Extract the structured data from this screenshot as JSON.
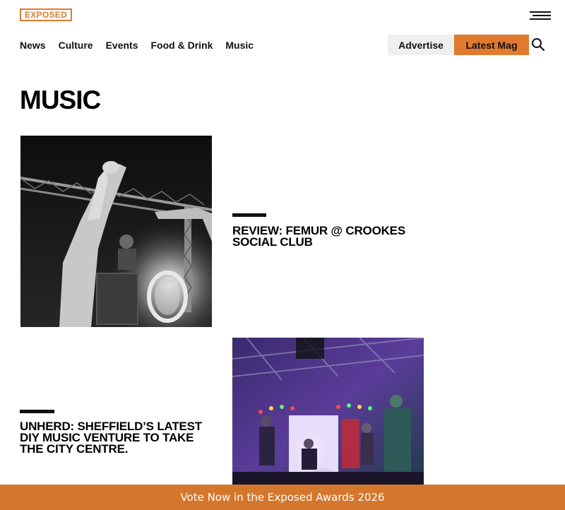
{
  "brand": {
    "logo_text": "EXPOSED",
    "accent_color": "#e07a2e"
  },
  "nav": {
    "items": [
      "News",
      "Culture",
      "Events",
      "Food & Drink",
      "Music"
    ],
    "advertise_label": "Advertise",
    "latest_mag_label": "Latest Mag"
  },
  "icons": {
    "menu": "hamburger-menu-icon",
    "search": "search-icon"
  },
  "page": {
    "title": "MUSIC"
  },
  "articles": [
    {
      "headline": "REVIEW: FEMUR @ CROOKES SOCIAL CLUB",
      "image": "black-and-white concert photo"
    },
    {
      "headline": "UNHERD: SHEFFIELD’S LATEST DIY MUSIC VENTURE TO TAKE THE CITY CENTRE.",
      "image": "colour band performance photo"
    }
  ],
  "banner": {
    "text": "Vote Now in the Exposed Awards 2026",
    "color": "#d4762b"
  }
}
